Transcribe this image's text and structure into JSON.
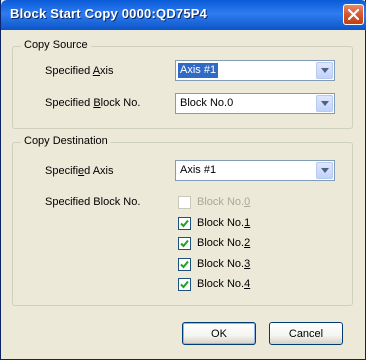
{
  "window": {
    "title": "Block Start Copy 0000:QD75P4"
  },
  "copy_source": {
    "legend": "Copy Source",
    "axis_label": "Specified Axis",
    "axis_value": "Axis #1",
    "block_label": "Specified Block No.",
    "block_value": "Block No.0"
  },
  "copy_destination": {
    "legend": "Copy Destination",
    "axis_label": "Specified Axis",
    "axis_value": "Axis #1",
    "block_label": "Specified Block No.",
    "blocks": [
      {
        "label": "Block No.0",
        "checked": false,
        "disabled": true
      },
      {
        "label": "Block No.1",
        "checked": true,
        "disabled": false
      },
      {
        "label": "Block No.2",
        "checked": true,
        "disabled": false
      },
      {
        "label": "Block No.3",
        "checked": true,
        "disabled": false
      },
      {
        "label": "Block No.4",
        "checked": true,
        "disabled": false
      }
    ]
  },
  "buttons": {
    "ok": "OK",
    "cancel": "Cancel"
  }
}
